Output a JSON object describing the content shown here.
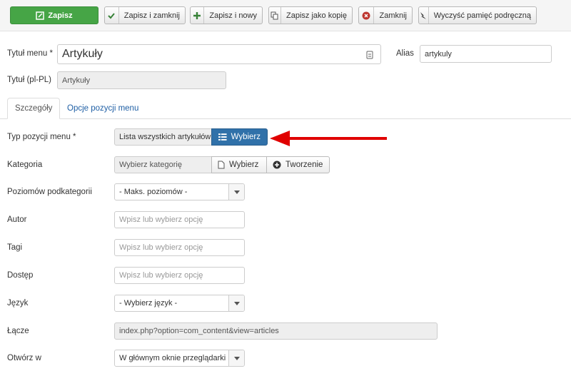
{
  "toolbar": {
    "save": "Zapisz",
    "save_close": "Zapisz i zamknij",
    "save_new": "Zapisz i nowy",
    "save_copy": "Zapisz jako kopię",
    "close": "Zamknij",
    "clear_cache": "Wyczyść pamięć podręczną"
  },
  "header": {
    "title_label": "Tytuł menu *",
    "title_value": "Artykuły",
    "alias_label": "Alias",
    "alias_value": "artykuly",
    "title_lang_label": "Tytuł (pl-PL)",
    "title_lang_value": "Artykuły"
  },
  "tabs": [
    {
      "label": "Szczegóły",
      "active": true
    },
    {
      "label": "Opcje pozycji menu",
      "active": false
    }
  ],
  "form": {
    "menu_type": {
      "label": "Typ pozycji menu *",
      "value": "Lista wszystkich artykułów",
      "button": "Wybierz"
    },
    "category": {
      "label": "Kategoria",
      "value": "Wybierz kategorię",
      "select_button": "Wybierz",
      "create_button": "Tworzenie"
    },
    "levels": {
      "label": "Poziomów podkategorii",
      "value": "- Maks. poziomów -"
    },
    "author": {
      "label": "Autor",
      "placeholder": "Wpisz lub wybierz opcję"
    },
    "tags": {
      "label": "Tagi",
      "placeholder": "Wpisz lub wybierz opcję"
    },
    "access": {
      "label": "Dostęp",
      "placeholder": "Wpisz lub wybierz opcję"
    },
    "language": {
      "label": "Język",
      "value": "- Wybierz język -"
    },
    "link": {
      "label": "Łącze",
      "value": "index.php?option=com_content&view=articles"
    },
    "open_in": {
      "label": "Otwórz w",
      "value": "W głównym oknie przeglądarki"
    }
  },
  "colors": {
    "primary_green": "#46a546",
    "select_blue": "#3071a9",
    "arrow_red": "#e00000",
    "link_blue": "#1f5fa5"
  }
}
